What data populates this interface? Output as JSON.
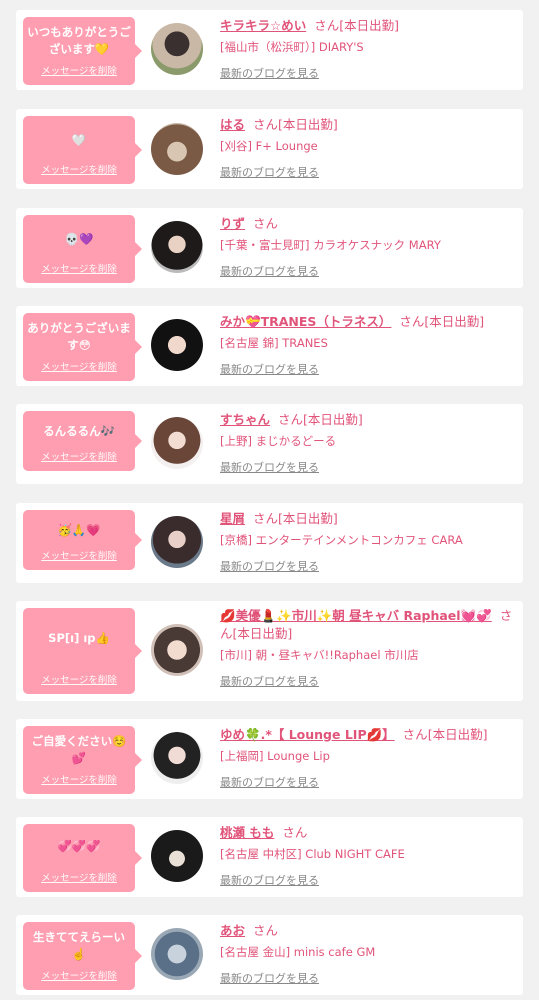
{
  "delete_label": "メッセージを削除",
  "san_label": "さん",
  "blog_label": "最新のブログを見る",
  "items": [
    {
      "message": "いつもありがとうございます💛",
      "name": "キラキラ☆めい",
      "status": "[本日出勤]",
      "shop": "[福山市（松浜町）] DIARY'S"
    },
    {
      "message": "🤍",
      "name": "はる",
      "status": "[本日出勤]",
      "shop": "[刈谷] F+ Lounge"
    },
    {
      "message": "💀💜",
      "name": "りず",
      "status": "",
      "shop": "[千葉・富士見町] カラオケスナック MARY"
    },
    {
      "message": "ありがとうございます😳",
      "name": "みか💝TRANES（トラネス）",
      "status": "[本日出勤]",
      "shop": "[名古屋 錦] TRANES"
    },
    {
      "message": "るんるるん🎶",
      "name": "すちゃん",
      "status": "[本日出勤]",
      "shop": "[上野] まじかるどーる"
    },
    {
      "message": "🥳🙏💗",
      "name": "星屑",
      "status": "[本日出勤]",
      "shop": "[京橋] エンターテインメントコンカフェ CARA"
    },
    {
      "message": "SP[ı] ıp👍",
      "name": "💋美優💄✨市川✨朝 昼キャバ Raphael💓💞",
      "status": "[本日出勤]",
      "shop": "[市川] 朝・昼キャバ!!Raphael 市川店"
    },
    {
      "message": "ご自愛ください☺️💕",
      "name": "ゆめ🍀.*【 Lounge LIP💋】",
      "status": "[本日出勤]",
      "shop": "[上福岡] Lounge Lip"
    },
    {
      "message": "💞💞💞",
      "name": "桃瀬 もも",
      "status": "",
      "shop": "[名古屋 中村区] Club NIGHT CAFE"
    },
    {
      "message": "生きててえらーい☝️",
      "name": "あお",
      "status": "",
      "shop": "[名古屋 金山] minis cafe GM"
    }
  ],
  "colors": {
    "accent": "#e1547a",
    "bubble": "#ff9eb0",
    "background": "#f1f1f1"
  }
}
